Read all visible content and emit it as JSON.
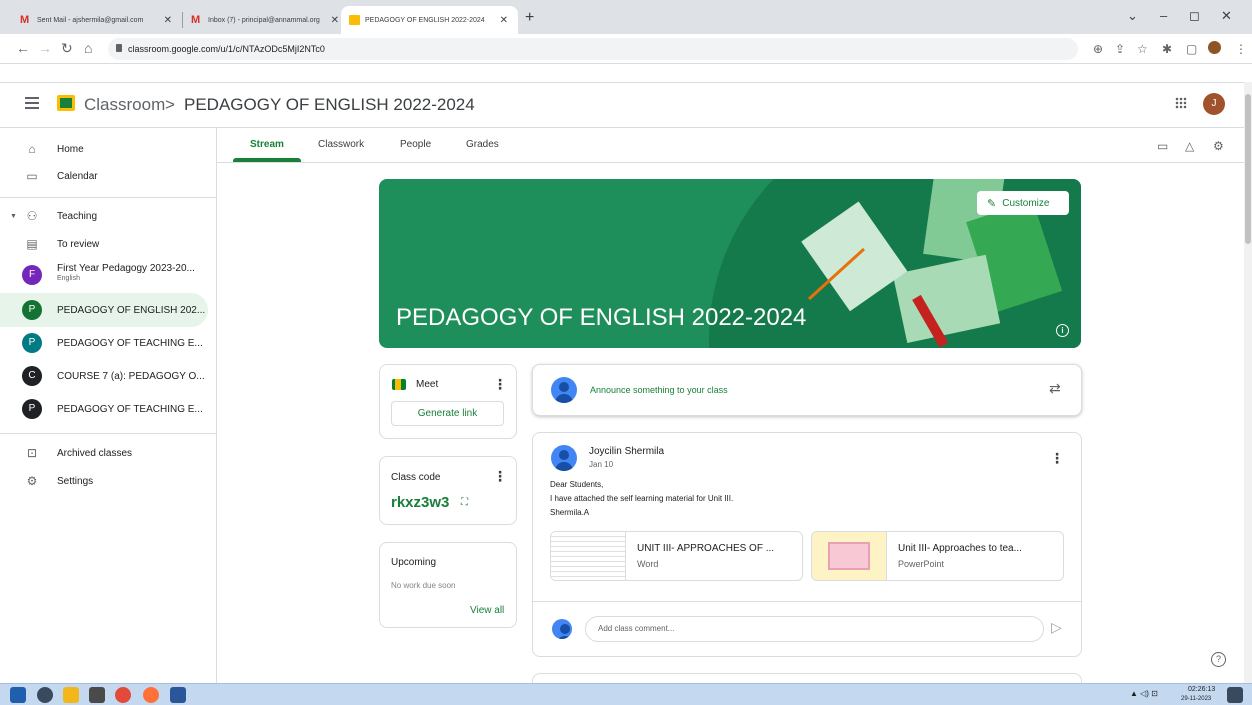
{
  "browser": {
    "tabs": [
      {
        "title": "Sent Mail - ajshermila@gmail.com"
      },
      {
        "title": "Inbox (7) - principal@annammal.org"
      },
      {
        "title": "PEDAGOGY OF ENGLISH 2022-2024"
      }
    ],
    "url": "classroom.google.com/u/1/c/NTAzODc5MjI2NTc0"
  },
  "header": {
    "app_title": "Classroom",
    "breadcrumb_sep": ">",
    "class_name": "PEDAGOGY OF ENGLISH 2022-2024",
    "avatar_letter": "J"
  },
  "sidebar": {
    "home": "Home",
    "calendar": "Calendar",
    "teaching": "Teaching",
    "to_review": "To review",
    "classes": [
      {
        "letter": "F",
        "name": "First Year Pedagogy 2023-20...",
        "sub": "English",
        "color": "#7627bb"
      },
      {
        "letter": "P",
        "name": "PEDAGOGY OF ENGLISH 202...",
        "sub": "",
        "color": "#137333"
      },
      {
        "letter": "P",
        "name": "PEDAGOGY OF TEACHING E...",
        "sub": "",
        "color": "#007b83"
      },
      {
        "letter": "C",
        "name": "COURSE 7 (a): PEDAGOGY O...",
        "sub": "",
        "color": "#202124"
      },
      {
        "letter": "P",
        "name": "PEDAGOGY OF TEACHING E...",
        "sub": "",
        "color": "#202124"
      }
    ],
    "archived": "Archived classes",
    "settings": "Settings"
  },
  "tabs": {
    "stream": "Stream",
    "classwork": "Classwork",
    "people": "People",
    "grades": "Grades"
  },
  "banner": {
    "title": "PEDAGOGY OF ENGLISH 2022-2024",
    "customize": "Customize",
    "info": "i"
  },
  "meet": {
    "label": "Meet",
    "generate": "Generate link"
  },
  "class_code": {
    "label": "Class code",
    "code": "rkxz3w3"
  },
  "upcoming": {
    "label": "Upcoming",
    "empty": "No work due soon",
    "view_all": "View all"
  },
  "announce": {
    "placeholder": "Announce something to your class"
  },
  "post": {
    "author": "Joycilin Shermila",
    "date": "Jan 10",
    "lines": [
      "Dear Students,",
      "I have attached the self learning material for Unit III.",
      "Shermila.A"
    ],
    "attachments": [
      {
        "title": "UNIT III- APPROACHES OF ...",
        "type": "Word"
      },
      {
        "title": "Unit III- Approaches to tea...",
        "type": "PowerPoint"
      }
    ],
    "comment_placeholder": "Add class comment..."
  },
  "taskbar": {
    "time": "02:26:13",
    "date": "29-11-2023"
  },
  "colors": {
    "accent": "#188038",
    "banner": "#1e8e5a"
  }
}
